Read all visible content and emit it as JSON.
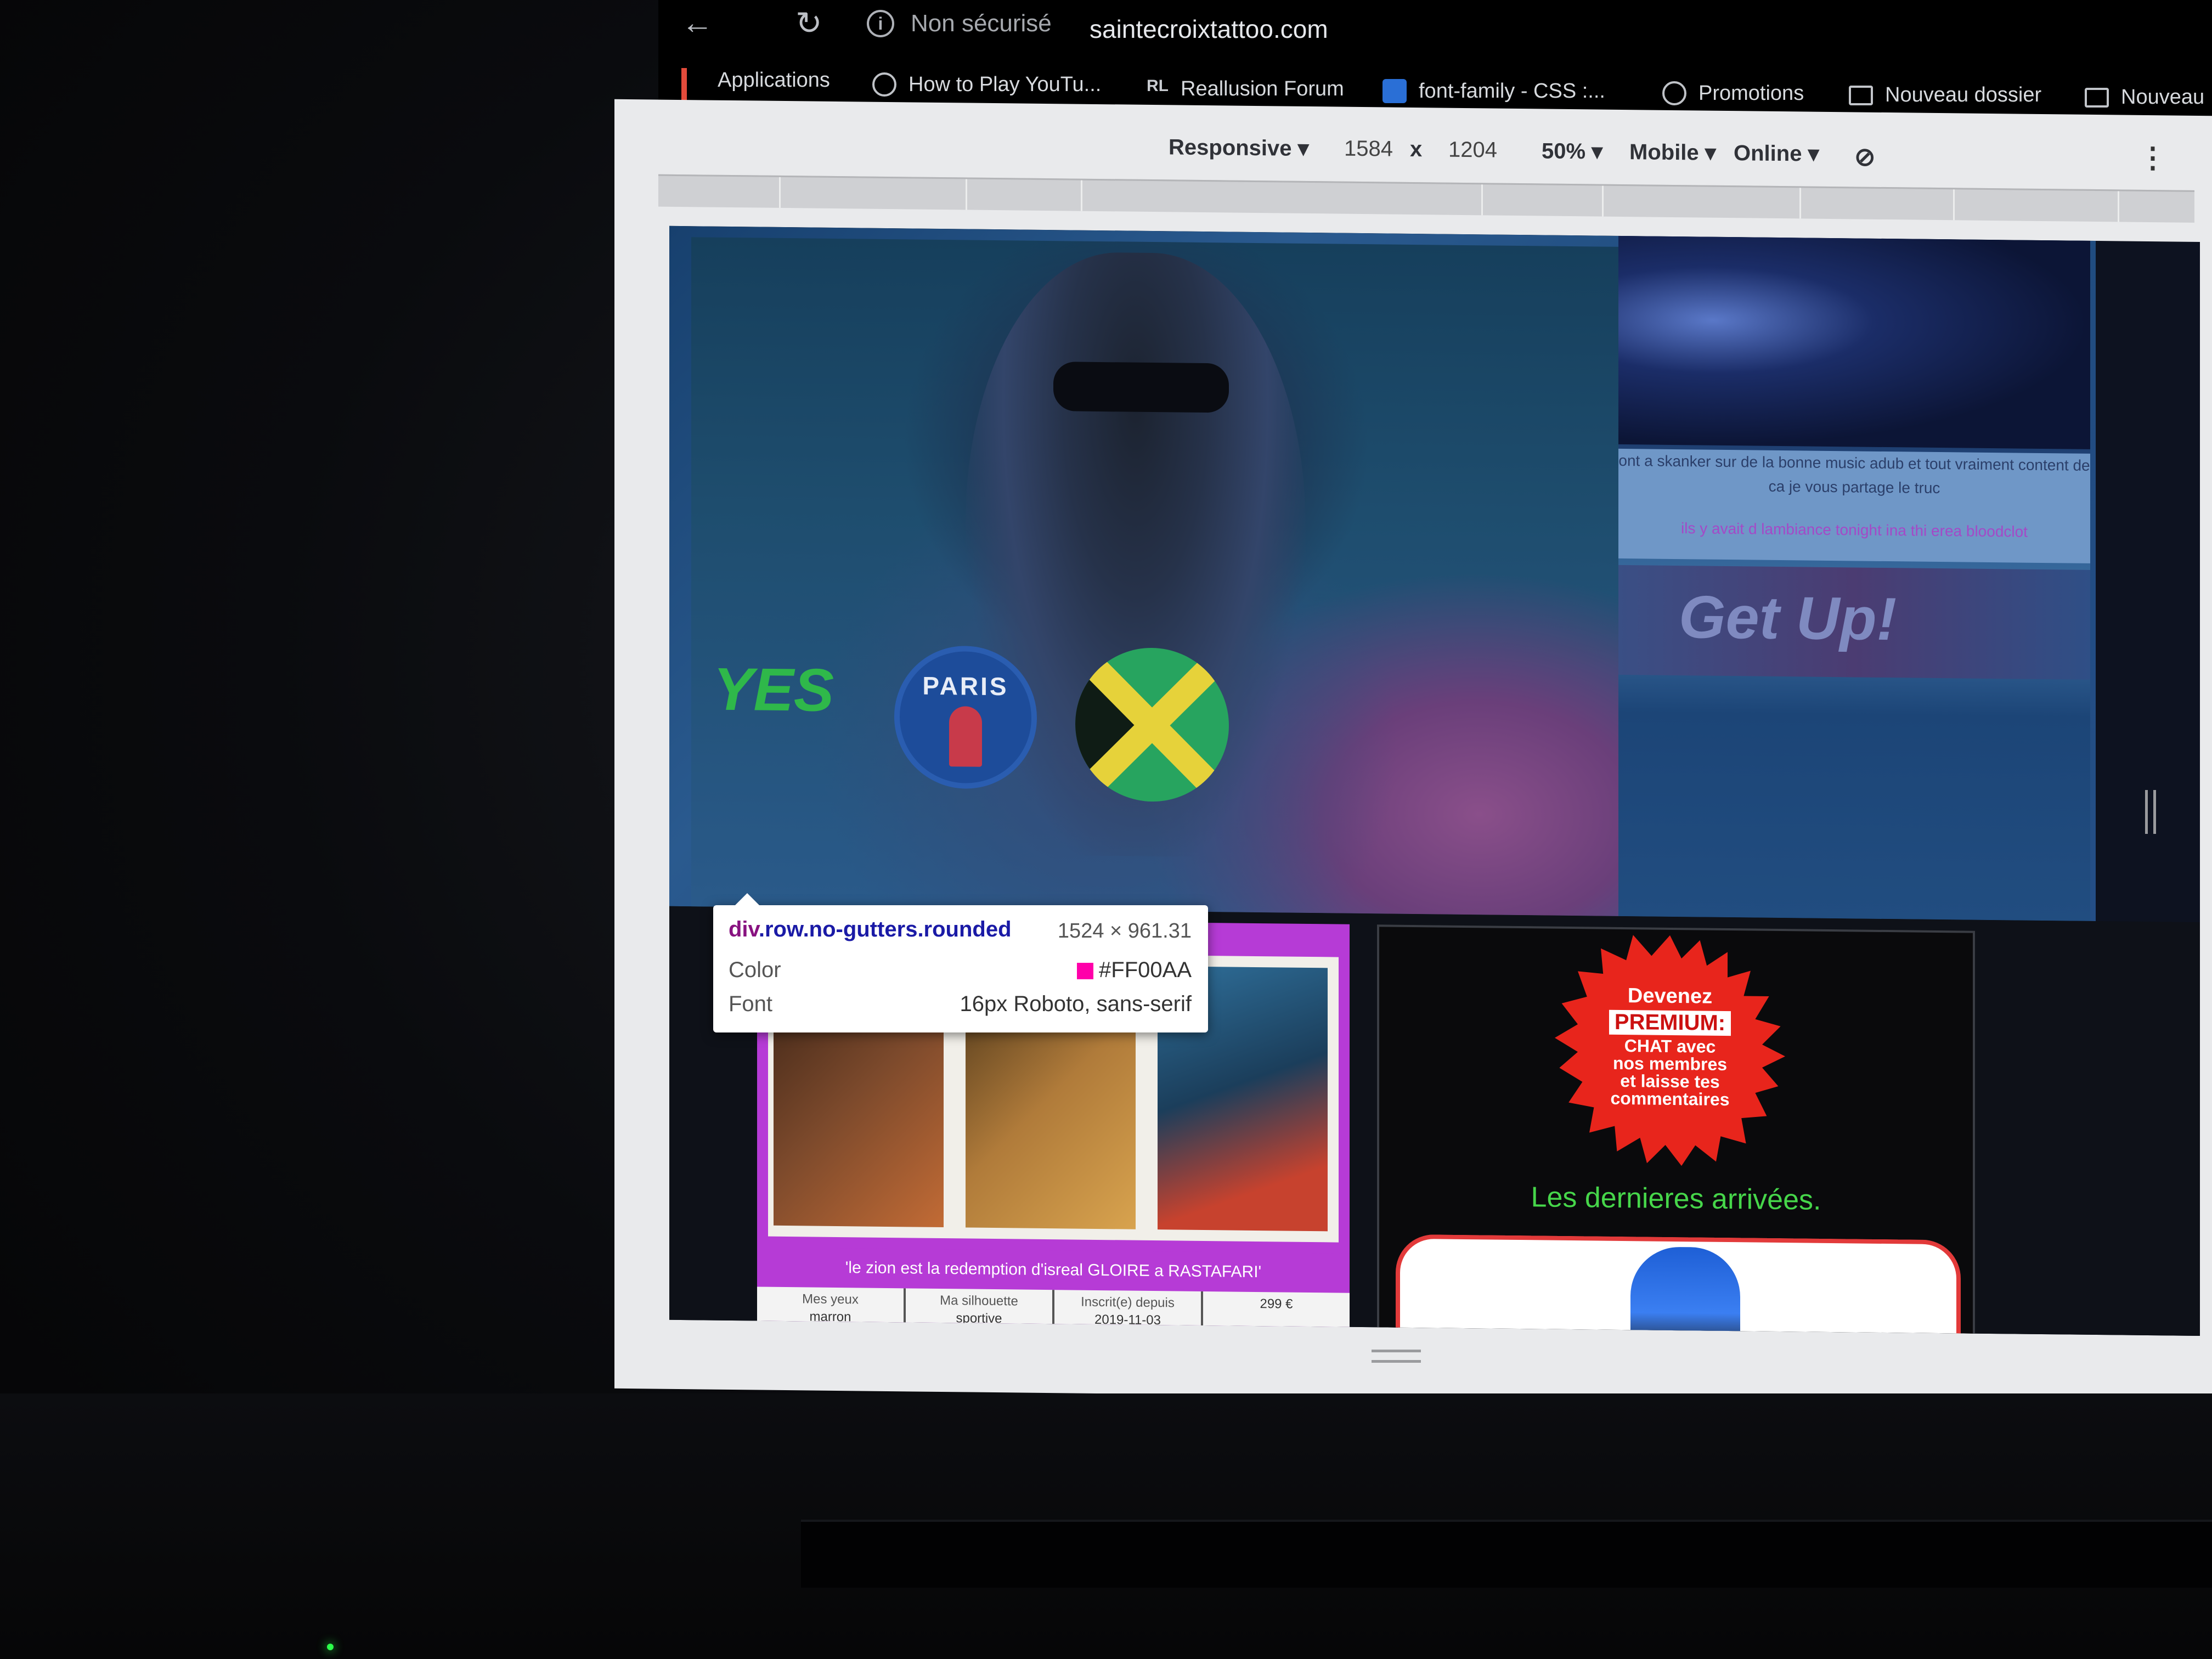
{
  "browser": {
    "security_label": "Non sécurisé",
    "url": "saintecroixtattoo.com",
    "bookmarks": [
      {
        "label": "Applications",
        "icon": "apps-grid-icon"
      },
      {
        "label": "How to Play YouTu...",
        "icon": "globe-icon"
      },
      {
        "label": "Reallusion Forum",
        "icon": "rl-logo-icon",
        "icon_text": "RL"
      },
      {
        "label": "font-family - CSS :...",
        "icon": "mdn-icon"
      },
      {
        "label": "Promotions",
        "icon": "globe-icon"
      },
      {
        "label": "Nouveau dossier",
        "icon": "folder-icon"
      },
      {
        "label": "Nouveau",
        "icon": "folder-icon"
      }
    ]
  },
  "device_toolbar": {
    "mode": "Responsive",
    "width": "1584",
    "times": "x",
    "height": "1204",
    "zoom": "50%",
    "device_class": "Mobile",
    "network": "Online"
  },
  "page": {
    "hero": {
      "yes_badge": "YES",
      "psg_text": "PARIS",
      "caption_line1": "ont a skanker sur de la bonne music adub et tout vraiment content de ca je vous partage le truc",
      "caption_line2": "ils y avait d lambiance tonight ina thi erea bloodclot",
      "banner_text": "Get Up!"
    },
    "profile_card": {
      "quote": "'le zion est la redemption d'isreal GLOIRE a RASTAFARI'",
      "stats": [
        {
          "label": "Mes yeux",
          "value": "marron"
        },
        {
          "label": "Ma silhouette",
          "value": "sportive"
        },
        {
          "label": "Inscrit(e) depuis",
          "value": "2019-11-03"
        },
        {
          "label": "",
          "value": "299 €"
        }
      ]
    },
    "premium": {
      "line1": "Devenez",
      "line2": "PREMIUM:",
      "line3": "CHAT avec",
      "line4": "nos membres",
      "line5": "et laisse tes",
      "line6": "commentaires",
      "arrivals_title": "Les dernieres arrivées."
    }
  },
  "inspect_tooltip": {
    "selector_tag": "div",
    "selector_classes": ".row.no-gutters.rounded",
    "size": "1524 × 961.31",
    "color_label": "Color",
    "color_value": "#FF00AA",
    "font_label": "Font",
    "font_value": "16px Roboto, sans-serif"
  },
  "colors": {
    "swatch": "#FF00AA",
    "accent_magenta": "#b63bd6",
    "premium_red": "#e8251c",
    "arrivals_green": "#46d64a"
  }
}
